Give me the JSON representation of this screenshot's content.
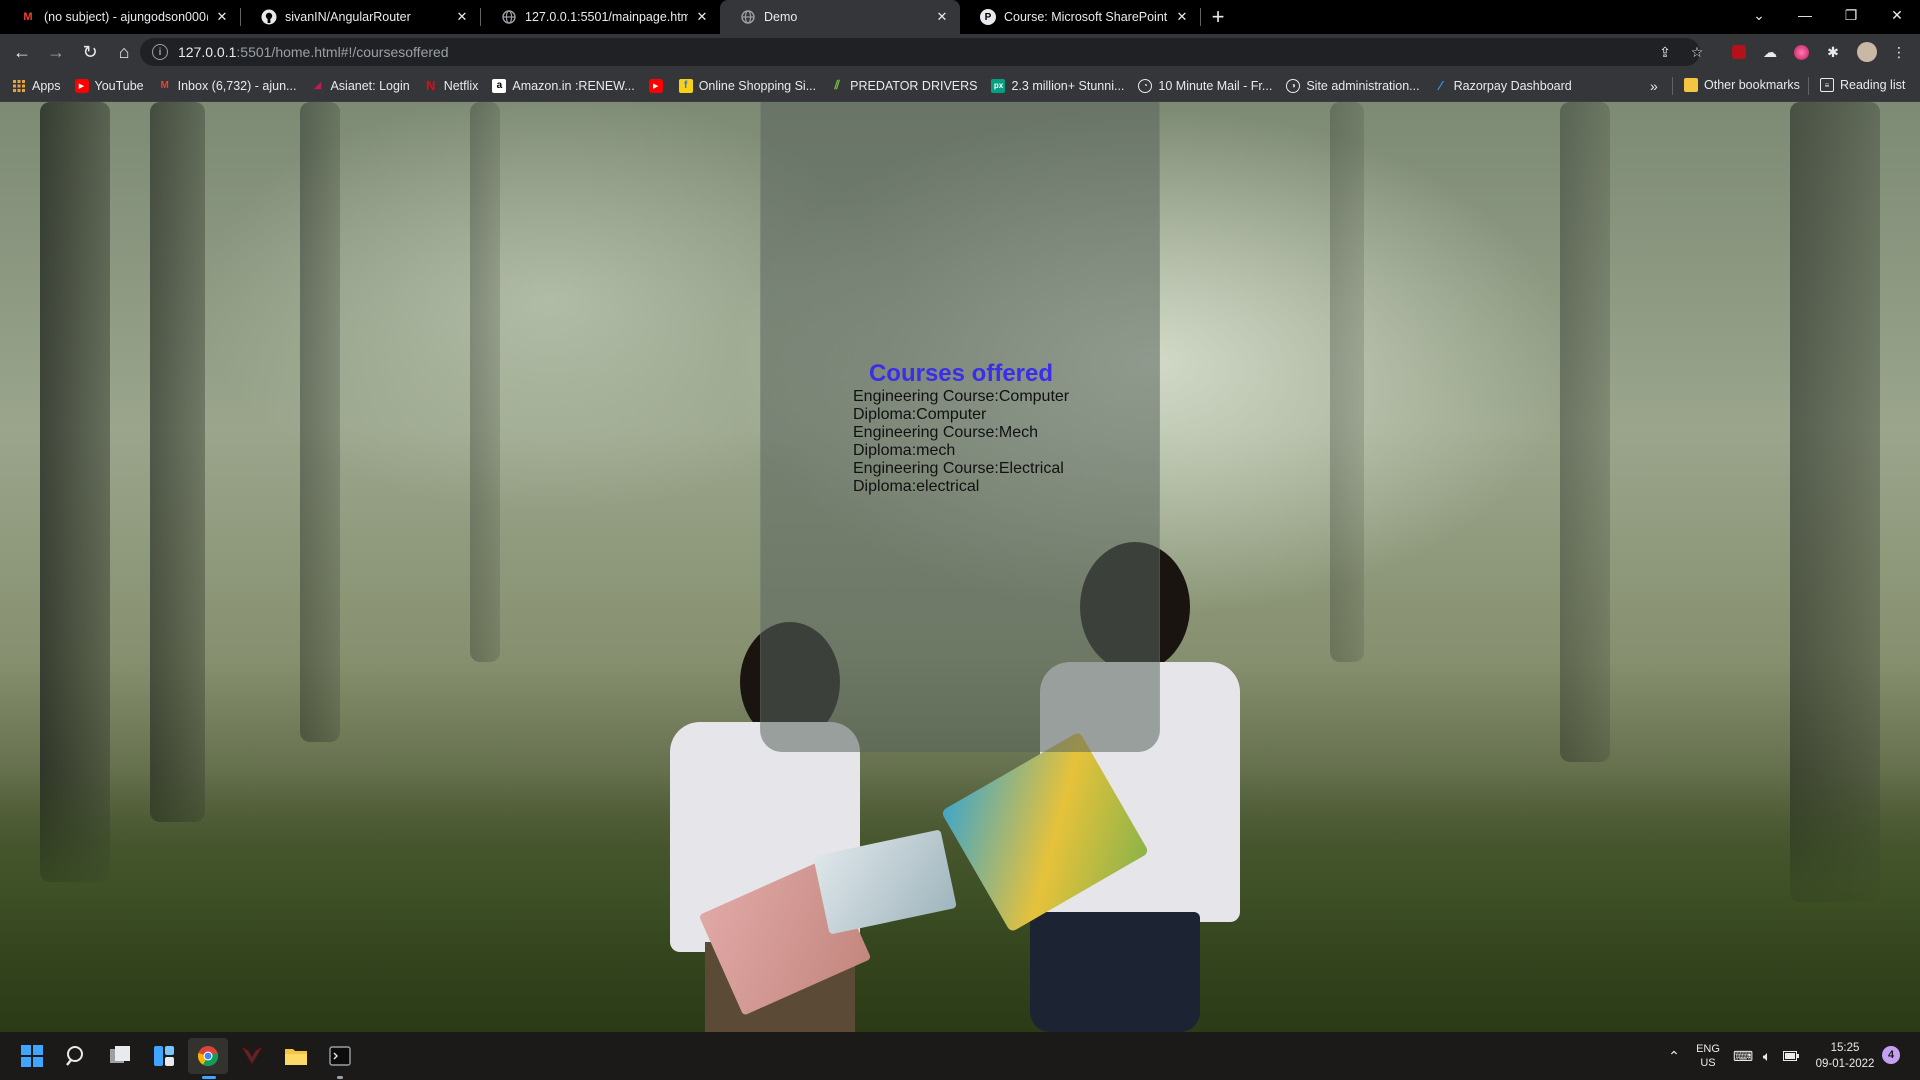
{
  "browser": {
    "tabs": [
      {
        "title": "(no subject) - ajungodson000@g",
        "icon": "gmail-icon",
        "active": false
      },
      {
        "title": "sivanIN/AngularRouter",
        "icon": "github-icon",
        "active": false
      },
      {
        "title": "127.0.0.1:5501/mainpage.html",
        "icon": "globe-icon",
        "active": false
      },
      {
        "title": "Demo",
        "icon": "globe-icon",
        "active": true
      },
      {
        "title": "Course: Microsoft SharePoint",
        "icon": "sharepoint-icon",
        "active": false
      }
    ],
    "address": {
      "host": "127.0.0.1",
      "path": ":5501/home.html#!/coursesoffered"
    },
    "bookmarks": [
      {
        "label": "Apps",
        "icon": "apps-grid-icon",
        "color": "#e8a33d"
      },
      {
        "label": "YouTube",
        "icon": "youtube-icon",
        "color": "#ff0000"
      },
      {
        "label": "Inbox (6,732) - ajun...",
        "icon": "gmail-icon",
        "color": "#ea4335"
      },
      {
        "label": "Asianet: Login",
        "icon": "asianet-icon",
        "color": "#c2185b"
      },
      {
        "label": "Netflix",
        "icon": "netflix-icon",
        "color": "#e50914"
      },
      {
        "label": "Amazon.in :RENEW...",
        "icon": "amazon-icon",
        "color": "#ffffff"
      },
      {
        "label": "",
        "icon": "youtube-icon",
        "color": "#ff0000"
      },
      {
        "label": "Online Shopping Si...",
        "icon": "flipkart-icon",
        "color": "#f7d117"
      },
      {
        "label": "PREDATOR DRIVERS",
        "icon": "predator-icon",
        "color": "#7ac943"
      },
      {
        "label": "2.3 million+ Stunni...",
        "icon": "pexels-icon",
        "color": "#05a081"
      },
      {
        "label": "10 Minute Mail - Fr...",
        "icon": "clock-icon",
        "color": "#e8eaed"
      },
      {
        "label": "Site administration...",
        "icon": "moodle-icon",
        "color": "#e8eaed"
      },
      {
        "label": "Razorpay Dashboard",
        "icon": "razorpay-icon",
        "color": "#3395ff"
      }
    ],
    "other_bookmarks": "Other bookmarks",
    "reading_list": "Reading list",
    "overflow": "»"
  },
  "page": {
    "title": "Courses offered",
    "courses": [
      "Engineering Course:Computer",
      "Diploma:Computer",
      "Engineering Course:Mech",
      "Diploma:mech",
      "Engineering Course:Electrical",
      "Diploma:electrical"
    ],
    "title_color": "#3a2ee8"
  },
  "taskbar": {
    "lang_line1": "ENG",
    "lang_line2": "US",
    "time": "15:25",
    "date": "09-01-2022",
    "notification_count": "4"
  }
}
